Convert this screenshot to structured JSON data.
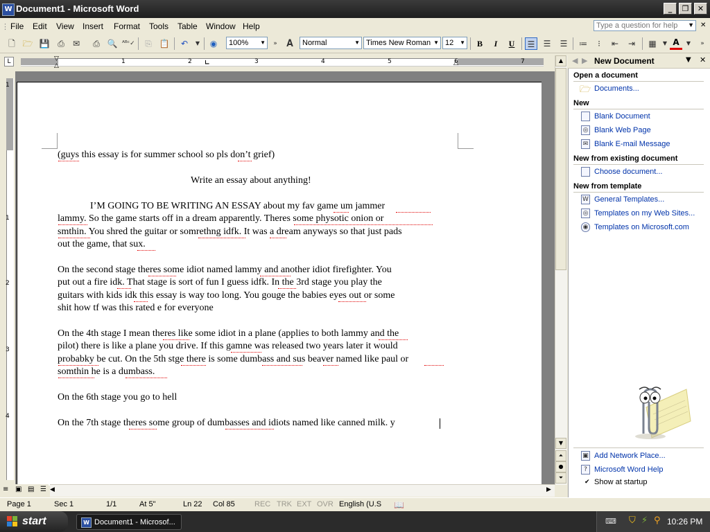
{
  "window": {
    "title": "Document1 - Microsoft Word",
    "app_icon": "W"
  },
  "menu": [
    "File",
    "Edit",
    "View",
    "Insert",
    "Format",
    "Tools",
    "Table",
    "Window",
    "Help"
  ],
  "help_box": {
    "placeholder": "Type a question for help"
  },
  "toolbar": {
    "zoom": "100%",
    "style": "Normal",
    "font": "Times New Roman",
    "size": "12",
    "bold": "B",
    "italic": "I",
    "underline": "U"
  },
  "ruler": {
    "h_numbers": [
      "1",
      "2",
      "3",
      "4",
      "5",
      "6",
      "7"
    ],
    "v_numbers": [
      "1",
      "1",
      "2",
      "3",
      "4"
    ]
  },
  "document": {
    "line1": "(guys this essay is for summer school so pls don’t grief)",
    "title": "Write an essay about anything!",
    "p1": [
      "I’M GOING TO BE WRITING AN ESSAY about my fav game um jammer",
      "lammy. So the game starts off in a dream apparently. Theres some physotic onion or",
      "smthin. You shred the guitar or somrethng idfk. It was a dream anyways so that just pads",
      "out the game, that sux."
    ],
    "p2": [
      "On the second stage theres some idiot named lammy and another idiot firefighter.  You",
      "put out a fire idk. That stage is sort of fun I guess idfk. In the 3rd stage you play the",
      "guitars with kids idk this essay is way too long.  You gouge the babies eyes out or some",
      "shit how tf was this rated e for everyone"
    ],
    "p3": [
      "On the 4th stage I mean theres like some idiot in a plane (applies to both lammy and the",
      "pilot) there is like a plane you drive. If this gamne was released two years later it would",
      "probabky be cut. On the 5th stge there is some dumbass and sus beaver named like paul or",
      "somthin he is a dumbass."
    ],
    "p4": "On the 6th stage you go to hell",
    "p5": "On the 7th stage theres some group of dumbasses and idiots named like canned milk.  y"
  },
  "task_pane": {
    "title": "New Document",
    "open_heading": "Open a document",
    "open_links": [
      "Documents..."
    ],
    "new_heading": "New",
    "new_links": [
      "Blank Document",
      "Blank Web Page",
      "Blank E-mail Message"
    ],
    "existing_heading": "New from existing document",
    "existing_links": [
      "Choose document..."
    ],
    "template_heading": "New from template",
    "template_links": [
      "General Templates...",
      "Templates on my Web Sites...",
      "Templates on Microsoft.com"
    ],
    "bottom_links": [
      "Add Network Place...",
      "Microsoft Word Help"
    ],
    "show_at_startup": "Show at startup"
  },
  "status": {
    "page": "Page  1",
    "sec": "Sec  1",
    "pages": "1/1",
    "at": "At  5\"",
    "ln": "Ln  22",
    "col": "Col  85",
    "rec": "REC",
    "trk": "TRK",
    "ext": "EXT",
    "ovr": "OVR",
    "lang": "English (U.S"
  },
  "taskbar": {
    "start": "start",
    "task": "Document1 - Microsof...",
    "clock": "10:26 PM"
  }
}
